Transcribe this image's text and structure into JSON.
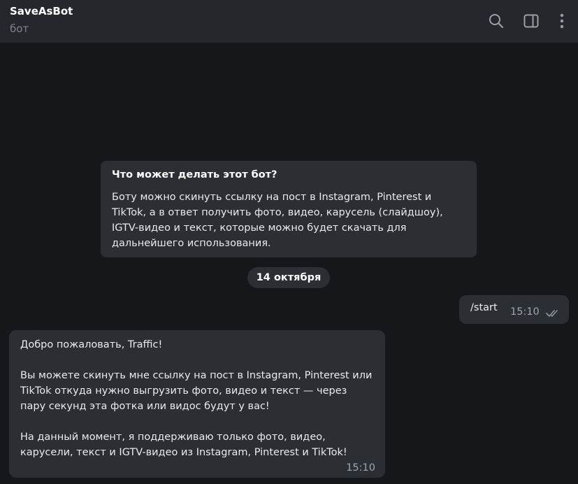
{
  "header": {
    "title": "SaveAsBot",
    "subtitle": "бот",
    "icons": [
      "search-icon",
      "sidebar-toggle-icon",
      "more-vertical-icon"
    ]
  },
  "intro": {
    "title": "Что может делать этот бот?",
    "text": "Боту можно скинуть ссылку на пост в Instagram, Pinterest и TikTok, а в ответ получить фото, видео, карусель (слайдшоу), IGTV-видео и текст, которые можно будет скачать для дальнейшего использования."
  },
  "date_separator": "14 октября",
  "outgoing": {
    "text": "/start",
    "time": "15:10",
    "status": "read"
  },
  "incoming": {
    "paragraphs": [
      "Добро пожаловать, Traffic!",
      "Вы можете скинуть мне ссылку на пост в Instagram, Pinterest или TikTok откуда нужно выгрузить фото, видео и текст — через пару секунд эта фотка или видос будут у вас!",
      "На данный момент, я поддерживаю только фото, видео, карусели, текст и IGTV-видео из Instagram, Pinterest и TikTok!"
    ],
    "time": "15:10"
  },
  "colors": {
    "header_bg": "#25272c",
    "chat_bg": "#16171a",
    "bubble_bg": "#2b2e33",
    "muted_text": "#7e848c",
    "tick": "#8e96a0"
  }
}
